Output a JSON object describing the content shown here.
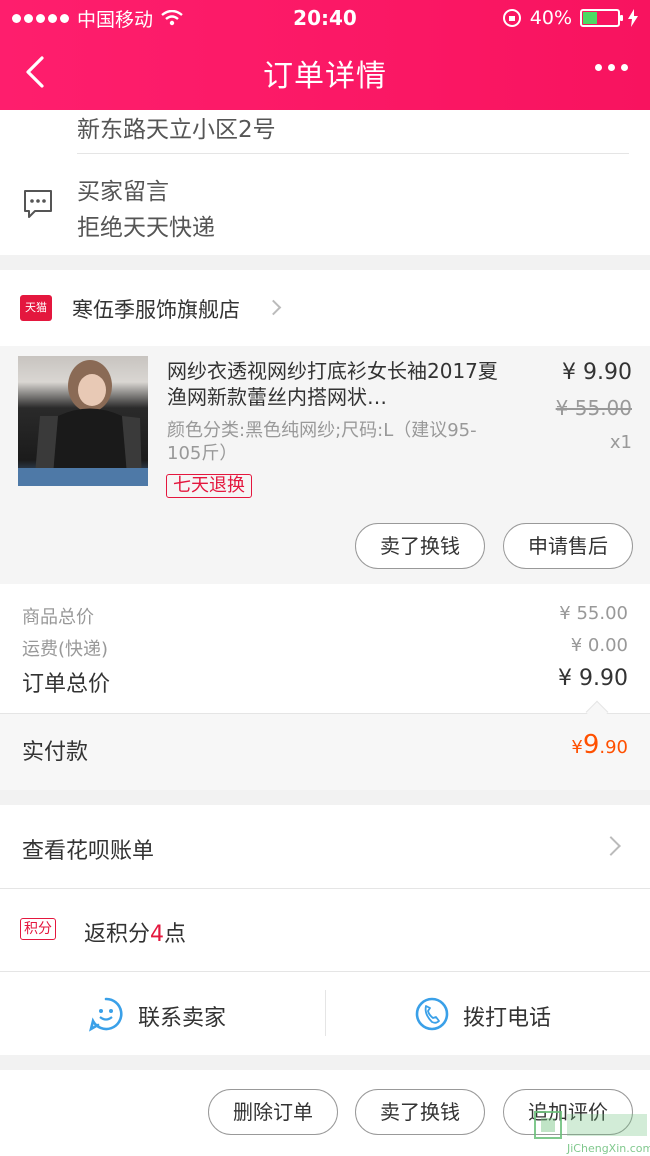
{
  "status_bar": {
    "carrier": "中国移动",
    "time": "20:40",
    "battery": "40%",
    "battery_level": 0.4
  },
  "nav": {
    "title": "订单详情"
  },
  "address": {
    "line": "新东路天立小区2号"
  },
  "buyer_message": {
    "title": "买家留言",
    "text": "拒绝天天快递"
  },
  "shop": {
    "badge": "天猫",
    "name": "寒伍季服饰旗舰店"
  },
  "product": {
    "title": "网纱衣透视网纱打底衫女长袖2017夏渔网新款蕾丝内搭网状…",
    "spec": "颜色分类:黑色纯网纱;尺码:L（建议95-105斤）",
    "badge": "七天退换",
    "price": "¥ 9.90",
    "original_price": "¥ 55.00",
    "quantity": "x1"
  },
  "product_actions": {
    "sell": "卖了换钱",
    "after_sale": "申请售后"
  },
  "summary": {
    "goods_total_label": "商品总价",
    "goods_total": "¥ 55.00",
    "shipping_label": "运费(快递)",
    "shipping": "¥ 0.00",
    "order_total_label": "订单总价",
    "order_total": "¥ 9.90",
    "paid_label": "实付款",
    "paid_currency": "¥",
    "paid_int": "9",
    "paid_dec": ".90"
  },
  "huabei": {
    "label": "查看花呗账单"
  },
  "points": {
    "badge": "积分",
    "prefix": "返积分",
    "value": "4",
    "suffix": "点"
  },
  "contact": {
    "seller": "联系卖家",
    "phone": "拨打电话"
  },
  "bottom_actions": {
    "delete": "删除订单",
    "sell": "卖了换钱",
    "review": "追加评价"
  },
  "watermark": {
    "text": "JiChengXin.com"
  },
  "colors": {
    "brand": "#fe1e6d",
    "accent_orange": "#ff5000",
    "tmall_red": "#e4173e",
    "icon_blue": "#3aa0e8"
  }
}
